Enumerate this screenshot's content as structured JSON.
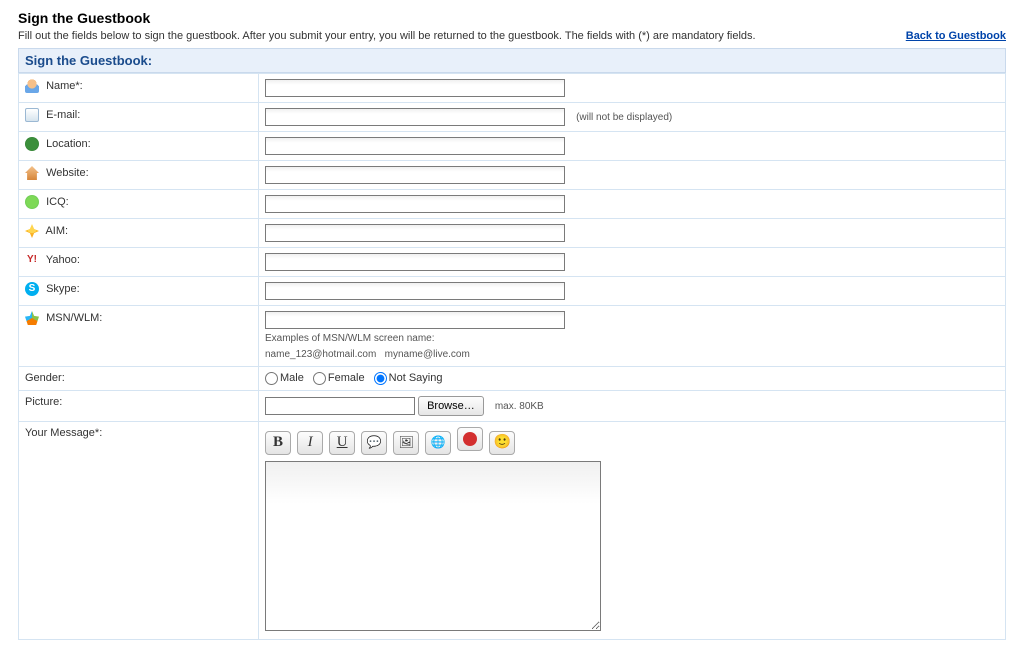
{
  "header": {
    "title": "Sign the Guestbook",
    "intro": "Fill out the fields below to sign the guestbook. After you submit your entry, you will be returned to the guestbook. The fields with (*) are mandatory fields.",
    "back_link": "Back to Guestbook"
  },
  "section_title": "Sign the Guestbook:",
  "fields": {
    "name": {
      "label": "Name*:",
      "icon": "person-icon",
      "color": "#e8b060",
      "value": ""
    },
    "email": {
      "label": "E-mail:",
      "icon": "mail-icon",
      "color": "#d6e4ee",
      "value": "",
      "hint": "(will not be displayed)"
    },
    "location": {
      "label": "Location:",
      "icon": "globe-icon",
      "color": "#2e7d32",
      "value": ""
    },
    "website": {
      "label": "Website:",
      "icon": "home-icon",
      "color": "#e8a05a",
      "value": ""
    },
    "icq": {
      "label": "ICQ:",
      "icon": "icq-icon",
      "color": "#5fbf3d",
      "value": ""
    },
    "aim": {
      "label": "AIM:",
      "icon": "aim-icon",
      "color": "#e6b800",
      "value": ""
    },
    "yahoo": {
      "label": "Yahoo:",
      "icon": "yahoo-icon",
      "color": "#c62828",
      "value": ""
    },
    "skype": {
      "label": "Skype:",
      "icon": "skype-icon",
      "color": "#00aff0",
      "value": ""
    },
    "msn": {
      "label": "MSN/WLM:",
      "icon": "msn-icon",
      "color": "#8bc34a",
      "value": "",
      "sub1": "Examples of MSN/WLM screen name:",
      "sub2": "name_123@hotmail.com   myname@live.com"
    }
  },
  "gender": {
    "label": "Gender:",
    "options": {
      "male": "Male",
      "female": "Female",
      "notsaying": "Not Saying"
    },
    "selected": "notsaying"
  },
  "picture": {
    "label": "Picture:",
    "button": "Browse…",
    "hint": "max. 80KB",
    "value": ""
  },
  "message": {
    "label": "Your Message*:",
    "value": "",
    "toolbar": {
      "bold": "B",
      "italic": "I",
      "underline": "U",
      "quote": "❝",
      "image": "🖼",
      "link": "🔗",
      "flash": "⚡",
      "smiley": "🙂"
    }
  }
}
